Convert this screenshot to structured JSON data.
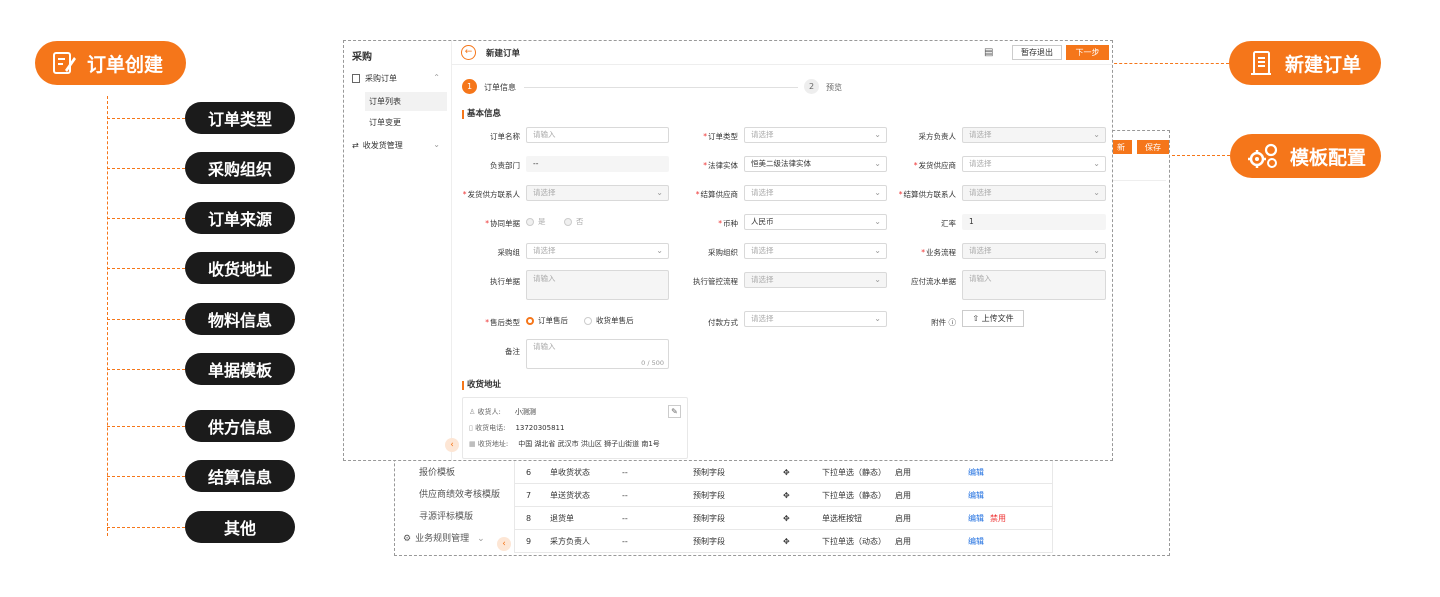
{
  "left_callout": {
    "title": "订单创建",
    "items": [
      "订单类型",
      "采购组织",
      "订单来源",
      "收货地址",
      "物料信息",
      "单据模板",
      "供方信息",
      "结算信息",
      "其他"
    ]
  },
  "right_callouts": {
    "new_order": "新建订单",
    "template_config": "模板配置"
  },
  "colors": {
    "accent": "#f5761a",
    "dark": "#1b1b1b",
    "link": "#1f6fe0",
    "danger": "#ee3333"
  },
  "main": {
    "sidebar": {
      "title": "采购",
      "group_purchase_order": "采购订单",
      "order_list": "订单列表",
      "order_change": "订单变更",
      "shipping_mgmt": "收发货管理"
    },
    "header": {
      "title": "新建订单",
      "save_exit": "暂存退出",
      "next": "下一步"
    },
    "steps": [
      {
        "num": "1",
        "label": "订单信息"
      },
      {
        "num": "2",
        "label": "预览"
      }
    ],
    "basic_title": "基本信息",
    "fields": {
      "order_name": {
        "label": "订单名称",
        "placeholder": "请输入"
      },
      "order_type": {
        "label": "订单类型",
        "placeholder": "请选择"
      },
      "purchaser": {
        "label": "采方负责人",
        "placeholder": "请选择"
      },
      "dept": {
        "label": "负责部门",
        "value": "--"
      },
      "legal_entity": {
        "label": "法律实体",
        "value": "恒美二级法律实体"
      },
      "ship_supplier": {
        "label": "发货供应商",
        "placeholder": "请选择"
      },
      "ship_contact": {
        "label": "发货供方联系人",
        "placeholder": "请选择"
      },
      "settle_supplier": {
        "label": "结算供应商",
        "placeholder": "请选择"
      },
      "settle_contact": {
        "label": "结算供方联系人",
        "placeholder": "请选择"
      },
      "collab": {
        "label": "协同单据",
        "yes": "是",
        "no": "否"
      },
      "currency": {
        "label": "币种",
        "value": "人民币"
      },
      "rate": {
        "label": "汇率",
        "value": "1"
      },
      "purchase_group": {
        "label": "采购组",
        "placeholder": "请选择"
      },
      "purchase_org": {
        "label": "采购组织",
        "placeholder": "请选择"
      },
      "biz_flow": {
        "label": "业务流程",
        "placeholder": "请选择"
      },
      "exec_doc": {
        "label": "执行单据",
        "placeholder": "请输入"
      },
      "exec_control": {
        "label": "执行管控流程",
        "placeholder": "请选择"
      },
      "payable_doc": {
        "label": "应付流水单据",
        "placeholder": "请输入"
      },
      "after_sale": {
        "label": "售后类型",
        "opt1": "订单售后",
        "opt2": "收货单售后"
      },
      "payment": {
        "label": "付款方式",
        "placeholder": "请选择"
      },
      "attachment": {
        "label": "附件",
        "button": "上传文件"
      },
      "remark": {
        "label": "备注",
        "placeholder": "请输入",
        "counter": "0 / 500"
      }
    },
    "address_title": "收货地址",
    "address": {
      "receiver_label": "收货人:",
      "receiver": "小测测",
      "phone_label": "收货电话:",
      "phone": "13720305811",
      "addr_label": "收货地址:",
      "addr": "中国 湖北省 武汉市 洪山区 狮子山街道 南1号"
    }
  },
  "back": {
    "buttons": [
      "新",
      "保存"
    ],
    "sidebar": [
      "报价模板",
      "供应商绩效考核模版",
      "寻源评标模版",
      "业务规则管理"
    ],
    "rows": [
      {
        "no": "6",
        "name": "单收货状态",
        "dash": "--",
        "kind": "预制字段",
        "ctrl": "下拉单选（静态）",
        "state": "启用",
        "edit": "编辑",
        "disable": ""
      },
      {
        "no": "7",
        "name": "单送货状态",
        "dash": "--",
        "kind": "预制字段",
        "ctrl": "下拉单选（静态）",
        "state": "启用",
        "edit": "编辑",
        "disable": ""
      },
      {
        "no": "8",
        "name": "退货单",
        "dash": "--",
        "kind": "预制字段",
        "ctrl": "单选框按钮",
        "state": "启用",
        "edit": "编辑",
        "disable": "禁用"
      },
      {
        "no": "9",
        "name": "采方负责人",
        "dash": "--",
        "kind": "预制字段",
        "ctrl": "下拉单选（动态）",
        "state": "启用",
        "edit": "编辑",
        "disable": ""
      }
    ]
  }
}
